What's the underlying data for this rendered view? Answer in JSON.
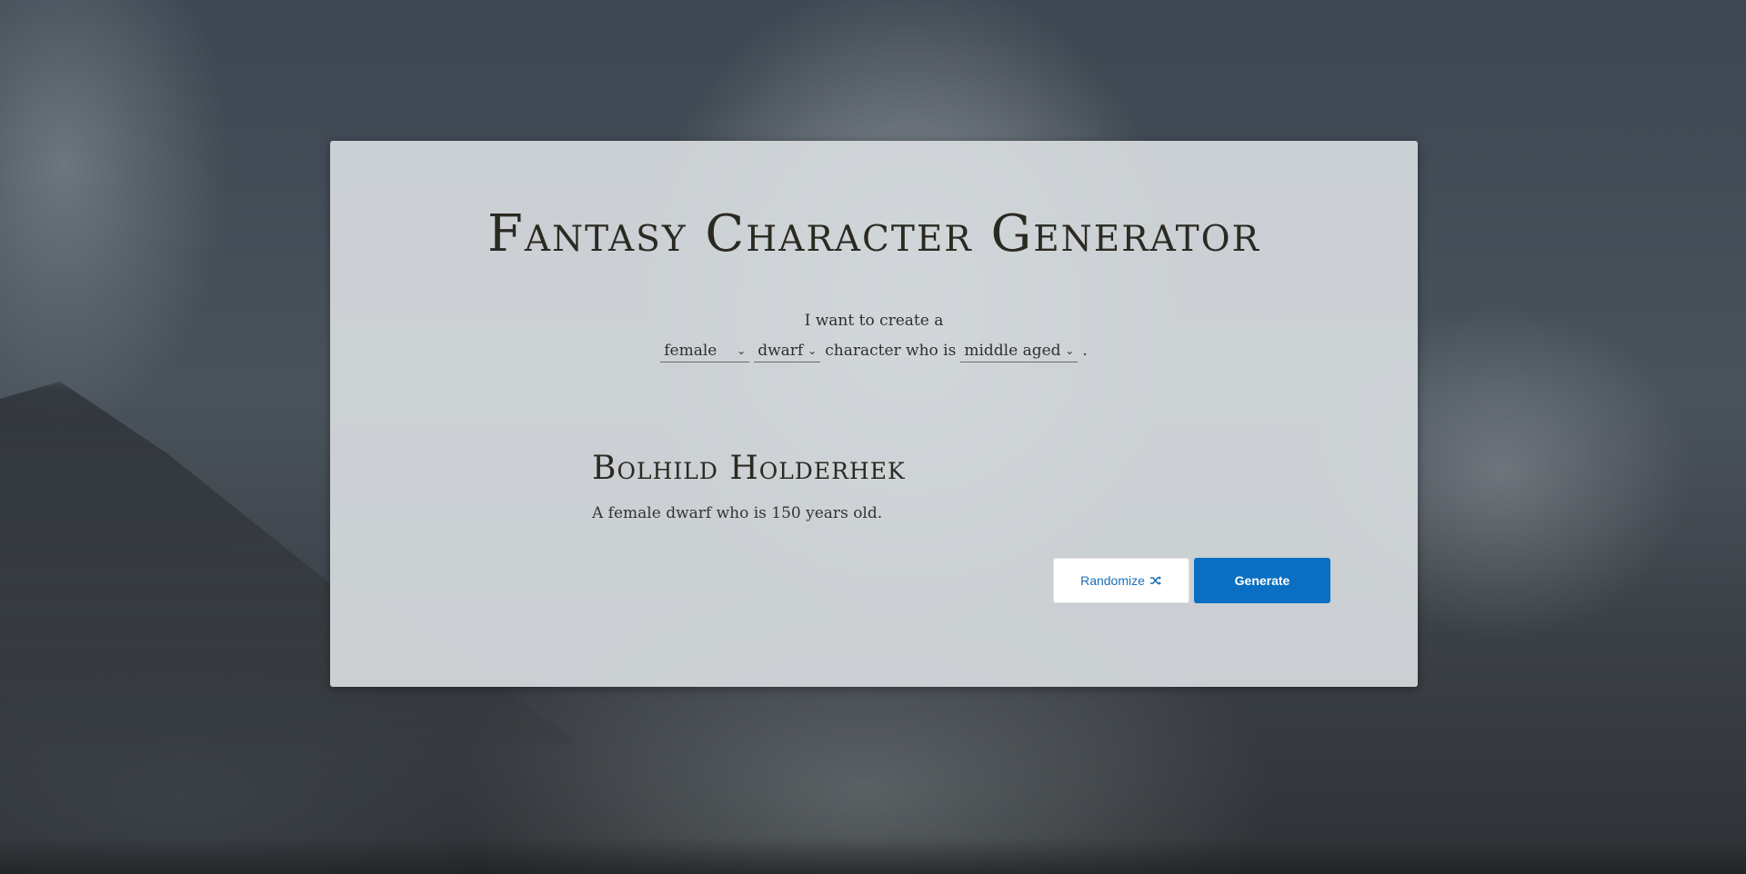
{
  "app": {
    "title": "Fantasy Character Generator"
  },
  "form": {
    "intro": "I want to create a",
    "gender": "female",
    "race": "dwarf",
    "connector": "character who is",
    "age": "middle aged",
    "period": "."
  },
  "result": {
    "name": "Bolhild Holderhek",
    "description": "A female dwarf who is 150 years old."
  },
  "buttons": {
    "randomize_label": "Randomize",
    "generate_label": "Generate"
  },
  "icons": {
    "randomize": "shuffle-icon",
    "dropdown": "chevron-down-icon"
  },
  "colors": {
    "primary": "#0a6fc2",
    "title_text": "#2b2a22",
    "card_background": "#d6dade"
  }
}
